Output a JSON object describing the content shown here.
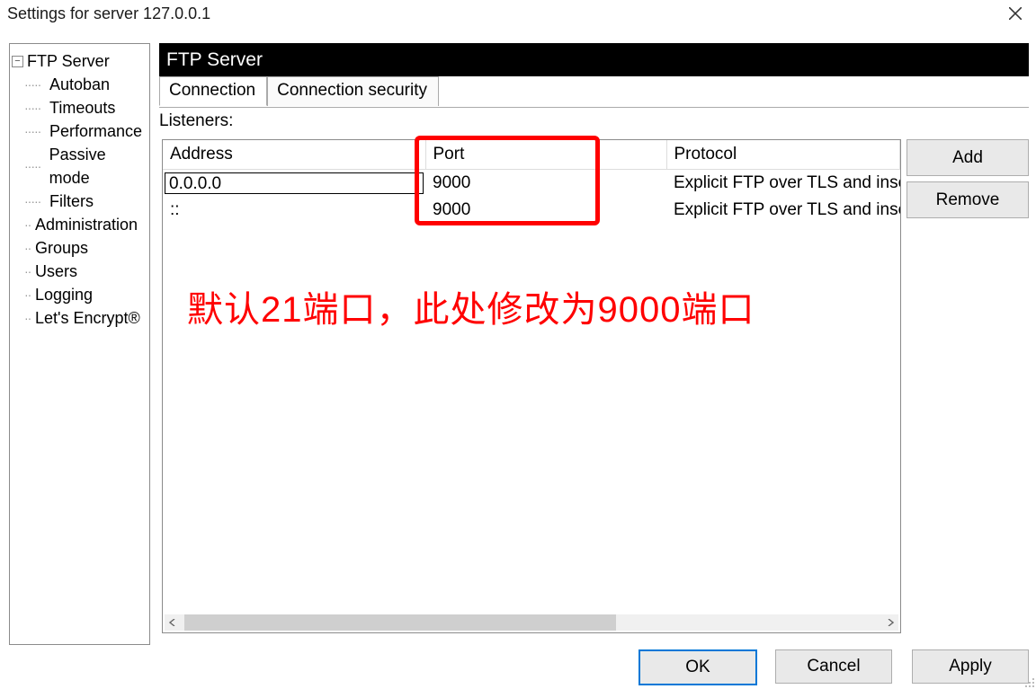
{
  "window_title": "Settings for server 127.0.0.1",
  "tree": {
    "root": "FTP Server",
    "children": [
      "Autoban",
      "Timeouts",
      "Performance",
      "Passive mode",
      "Filters"
    ],
    "top_level": [
      "Administration",
      "Groups",
      "Users",
      "Logging",
      "Let's Encrypt®"
    ]
  },
  "section_header": "FTP Server",
  "tabs": {
    "active": "Connection",
    "inactive": "Connection security"
  },
  "listeners_label": "Listeners:",
  "table": {
    "headers": {
      "address": "Address",
      "port": "Port",
      "protocol": "Protocol"
    },
    "rows": [
      {
        "address": "0.0.0.0",
        "port": "9000",
        "protocol": "Explicit FTP over TLS and insecure plain FTP",
        "editing": true
      },
      {
        "address": "::",
        "port": "9000",
        "protocol": "Explicit FTP over TLS and insecure plain FTP",
        "editing": false
      }
    ]
  },
  "annotation_text": "默认21端口，此处修改为9000端口",
  "buttons": {
    "add": "Add",
    "remove": "Remove",
    "ok": "OK",
    "cancel": "Cancel",
    "apply": "Apply"
  }
}
